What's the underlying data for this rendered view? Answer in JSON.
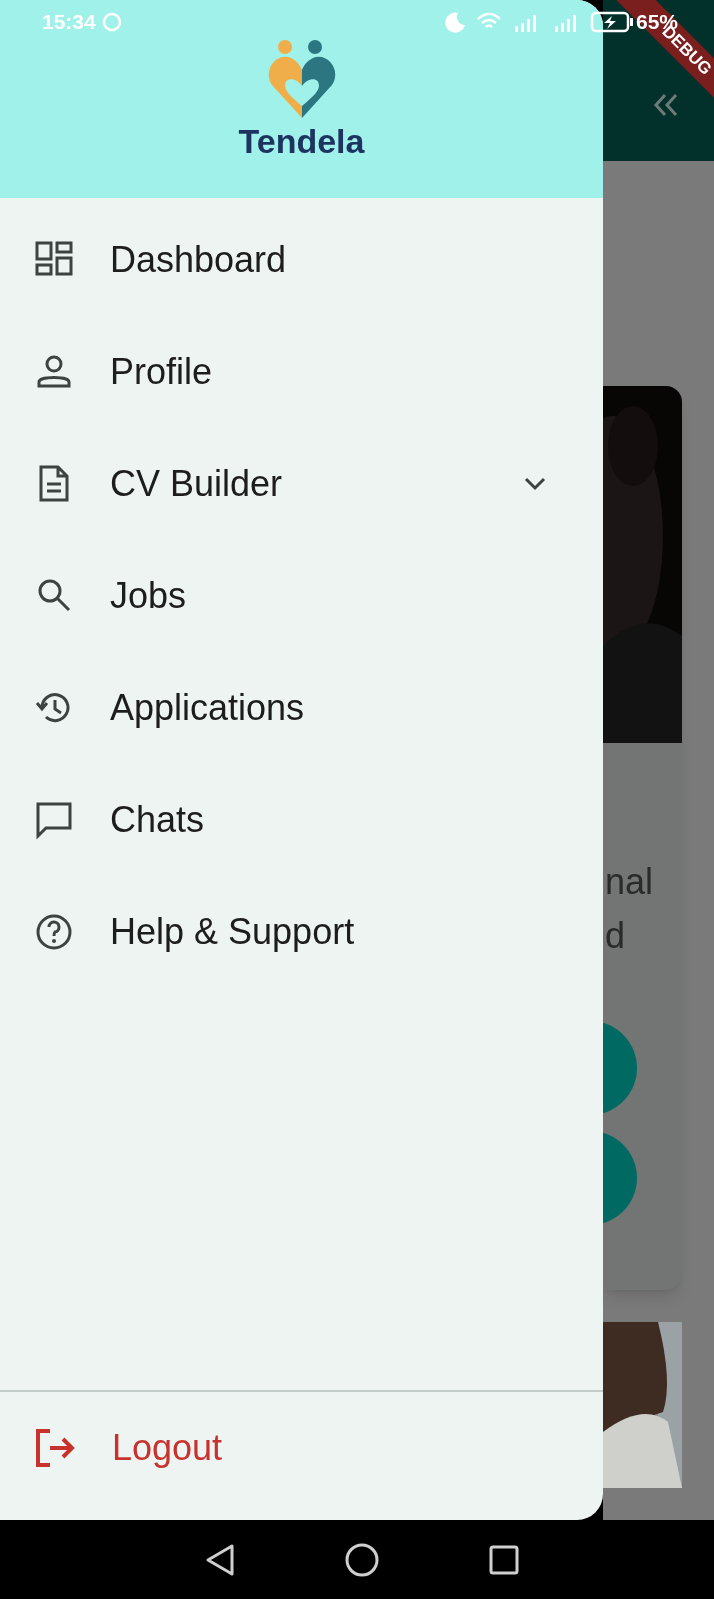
{
  "status_bar": {
    "time": "15:34",
    "battery": "65%"
  },
  "debug_banner": "DEBUG",
  "drawer": {
    "app_name": "Tendela",
    "menu": [
      {
        "label": "Dashboard",
        "kind": "link"
      },
      {
        "label": "Profile",
        "kind": "link"
      },
      {
        "label": "CV Builder",
        "kind": "group",
        "expanded": false
      },
      {
        "label": "Jobs",
        "kind": "link"
      },
      {
        "label": "Applications",
        "kind": "link"
      },
      {
        "label": "Chats",
        "kind": "link"
      },
      {
        "label": "Help & Support",
        "kind": "link"
      }
    ],
    "logout": "Logout"
  },
  "background": {
    "card_text": [
      "nal",
      "d"
    ]
  }
}
